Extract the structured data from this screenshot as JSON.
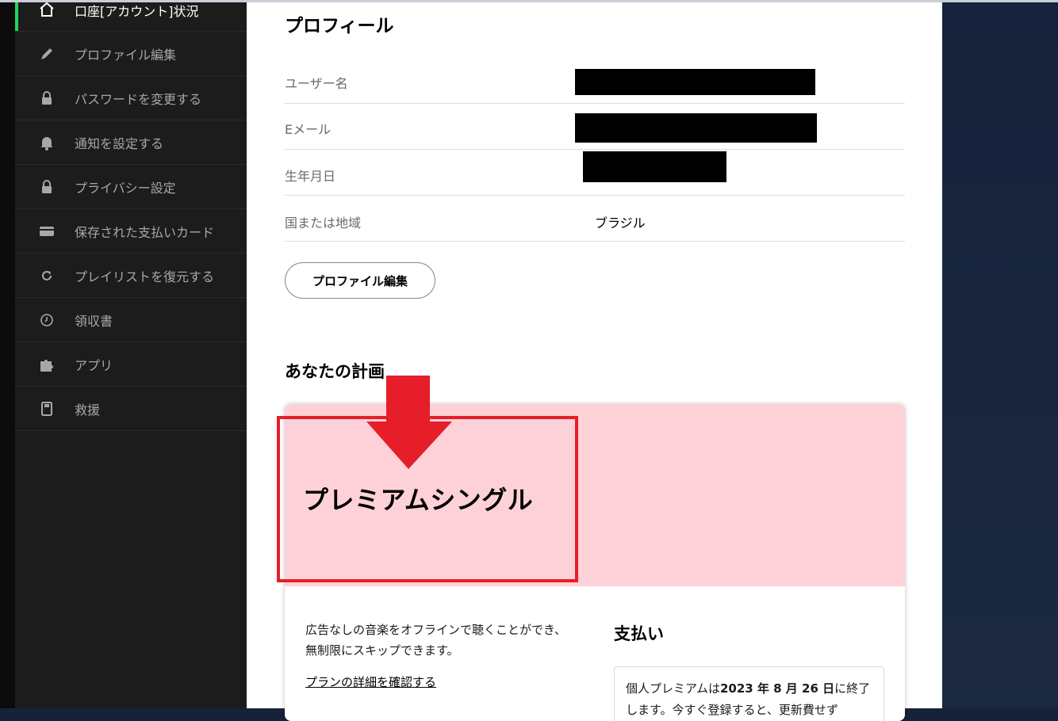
{
  "sidebar": {
    "items": [
      {
        "label": "口座[アカウント]状況",
        "icon": "home-icon"
      },
      {
        "label": "プロファイル編集",
        "icon": "pencil-icon"
      },
      {
        "label": "パスワードを変更する",
        "icon": "lock-icon"
      },
      {
        "label": "通知を設定する",
        "icon": "bell-icon"
      },
      {
        "label": "プライバシー設定",
        "icon": "lock-icon"
      },
      {
        "label": "保存された支払いカード",
        "icon": "card-icon"
      },
      {
        "label": "プレイリストを復元する",
        "icon": "restore-icon"
      },
      {
        "label": "領収書",
        "icon": "clock-icon"
      },
      {
        "label": "アプリ",
        "icon": "puzzle-icon"
      },
      {
        "label": "救援",
        "icon": "help-icon"
      }
    ],
    "active_color": "#1ed760"
  },
  "profile": {
    "title": "プロフィール",
    "rows": [
      {
        "label": "ユーザー名",
        "value": ""
      },
      {
        "label": "Eメール",
        "value": ""
      },
      {
        "label": "生年月日",
        "value": ""
      },
      {
        "label": "国または地域",
        "value": "ブラジル"
      }
    ],
    "edit_button": "プロファイル編集"
  },
  "plan": {
    "section_title": "あなたの計画",
    "name": "プレミアムシングル",
    "description": "広告なしの音楽をオフラインで聴くことができ、無制限にスキップできます。",
    "details_link": "プランの詳細を確認する",
    "payment_title": "支払い",
    "payment_text_1": "個人プレミアムは",
    "payment_date": "2023 年 8 月 26 日",
    "payment_text_2": "に終了します。今すぐ登録すると、更新費せず"
  },
  "colors": {
    "plan_header_bg": "#fed1d8",
    "annotation_red": "#e61e2a"
  }
}
